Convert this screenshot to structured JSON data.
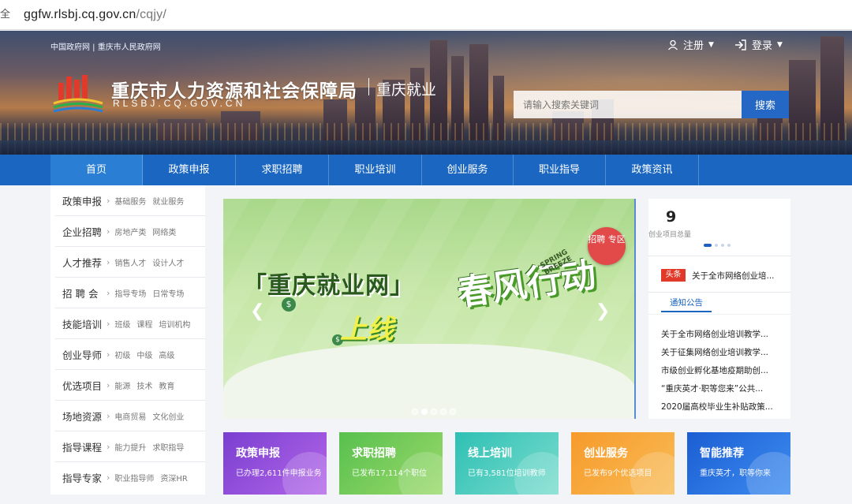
{
  "browser": {
    "url_host": "ggfw.rlsbj.cq.gov.cn",
    "url_path": "/cqjy/",
    "security_icon": "info-icon"
  },
  "header": {
    "top_links": "中国政府网 | 重庆市人民政府网",
    "site_title": "重庆市人力资源和社会保障局",
    "site_domain": "RLSBJ.CQ.GOV.CN",
    "site_sub": "重庆就业",
    "register_label": "注册",
    "login_label": "登录",
    "search_placeholder": "请输入搜索关键词",
    "search_button": "搜索"
  },
  "nav": [
    "首页",
    "政策申报",
    "求职招聘",
    "职业培训",
    "创业服务",
    "职业指导",
    "政策资讯"
  ],
  "sidebar": [
    {
      "main": "政策申报",
      "subs": [
        "基础服务",
        "就业服务"
      ]
    },
    {
      "main": "企业招聘",
      "subs": [
        "房地产类",
        "网络类"
      ]
    },
    {
      "main": "人才推荐",
      "subs": [
        "销售人才",
        "设计人才"
      ]
    },
    {
      "main": "招 聘 会",
      "subs": [
        "指导专场",
        "日常专场"
      ]
    },
    {
      "main": "技能培训",
      "subs": [
        "班级",
        "课程",
        "培训机构"
      ]
    },
    {
      "main": "创业导师",
      "subs": [
        "初级",
        "中级",
        "高级"
      ]
    },
    {
      "main": "优选项目",
      "subs": [
        "能源",
        "技术",
        "教育"
      ]
    },
    {
      "main": "场地资源",
      "subs": [
        "电商贸易",
        "文化创业"
      ]
    },
    {
      "main": "指导课程",
      "subs": [
        "能力提升",
        "求职指导"
      ]
    },
    {
      "main": "指导专家",
      "subs": [
        "职业指导师",
        "资深HR"
      ]
    }
  ],
  "slider": {
    "title": "「重庆就业网」",
    "big_text": "春风行动",
    "online_text": "上线",
    "spring_text": "SPRING BREEZE",
    "badge": "招聘 专区",
    "prev_icon": "chevron-left-icon",
    "next_icon": "chevron-right-icon",
    "dot_count": 5,
    "active_dot": 1
  },
  "right_panel": {
    "stat_value": "9",
    "stat_label": "创业项目总量",
    "headline_tag": "头条",
    "headline_text": "关于全市网络创业培...",
    "notice_tab": "通知公告",
    "notices": [
      "关于全市网络创业培训教学...",
      "关于征集网络创业培训教学...",
      "市级创业孵化基地疫期助创...",
      "“重庆英才·职等您来”公共...",
      "2020届高校毕业生补贴政策..."
    ]
  },
  "cards": [
    {
      "title": "政策申报",
      "desc": "已办理2,611件申报业务",
      "color_from": "#7a3fd0",
      "color_to": "#b265e8"
    },
    {
      "title": "求职招聘",
      "desc": "已发布17,114个职位",
      "color_from": "#58c04e",
      "color_to": "#9ad96a"
    },
    {
      "title": "线上培训",
      "desc": "已有3,581位培训教师",
      "color_from": "#2ec0b4",
      "color_to": "#7adccd"
    },
    {
      "title": "创业服务",
      "desc": "已发布9个优选项目",
      "color_from": "#f79a2b",
      "color_to": "#f8bc55"
    },
    {
      "title": "智能推荐",
      "desc": "重庆英才，职等你来",
      "color_from": "#1b5ed3",
      "color_to": "#3d8cf0"
    }
  ]
}
